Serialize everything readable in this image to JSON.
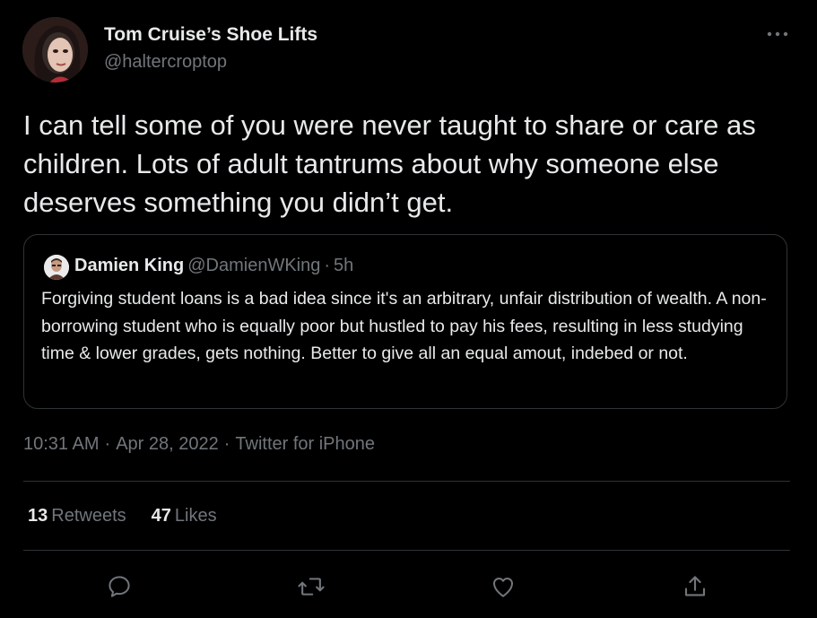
{
  "author": {
    "name": "Tom Cruise’s Shoe Lifts",
    "handle": "@haltercroptop"
  },
  "tweet": {
    "text": "I can tell some of you were never taught to share or care as children. Lots of adult tantrums about why someone else deserves something you didn’t get."
  },
  "quote": {
    "name": "Damien King",
    "handle": "@DamienWKing",
    "separator": "·",
    "time": "5h",
    "text": "Forgiving student loans is a bad idea since it's an arbitrary, unfair distribution of wealth. A non-borrowing student who is equally poor but hustled to pay his fees, resulting in less studying time & lower grades, gets nothing. Better to give all an equal amout, indebed or not."
  },
  "meta": {
    "time": "10:31 AM",
    "date": "Apr 28, 2022",
    "source": "Twitter for iPhone",
    "separator": "·"
  },
  "stats": {
    "retweets_count": "13",
    "retweets_label": "Retweets",
    "likes_count": "47",
    "likes_label": "Likes"
  },
  "actions": {
    "icons": [
      "reply-icon",
      "retweet-icon",
      "like-icon",
      "share-icon"
    ]
  },
  "colors": {
    "background": "#000000",
    "text_primary": "#e7e9ea",
    "text_secondary": "#71767b",
    "border": "#2f3336"
  }
}
